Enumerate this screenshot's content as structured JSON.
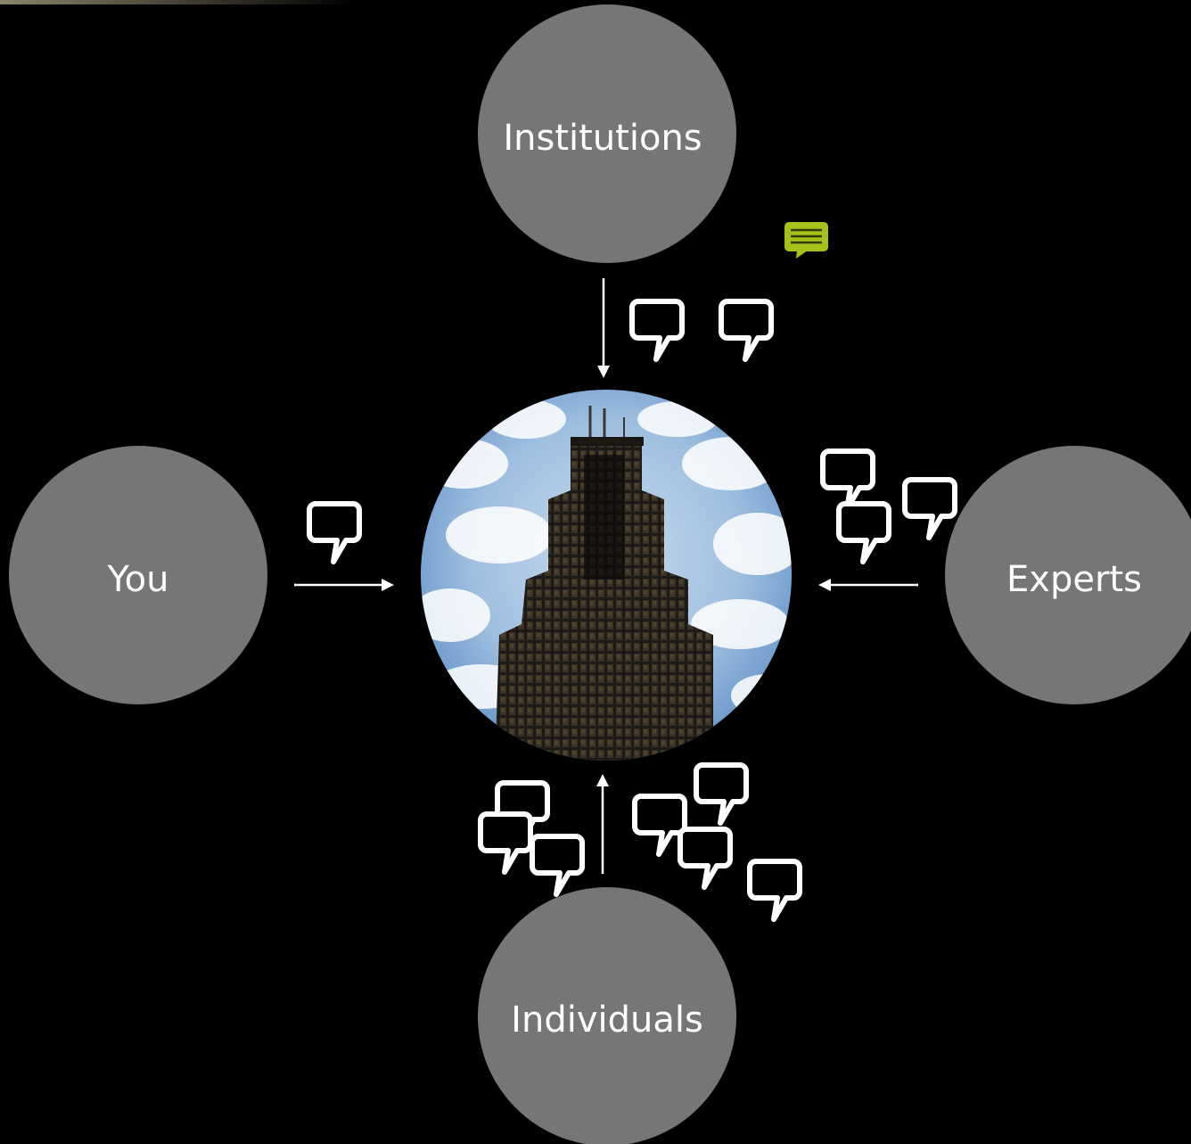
{
  "nodes": {
    "institutions": "Institutions",
    "you": "You",
    "experts": "Experts",
    "individuals": "Individuals"
  },
  "colors": {
    "background": "#000000",
    "node_fill": "#767676",
    "node_text": "#ffffff",
    "line": "#ffffff",
    "comment_accent": "#a6c21a",
    "top_rule": "#6f6a55"
  },
  "icons": {
    "center": "skyscraper-photo",
    "speech": "speech-bubble-icon",
    "note": "comment-note-icon"
  }
}
